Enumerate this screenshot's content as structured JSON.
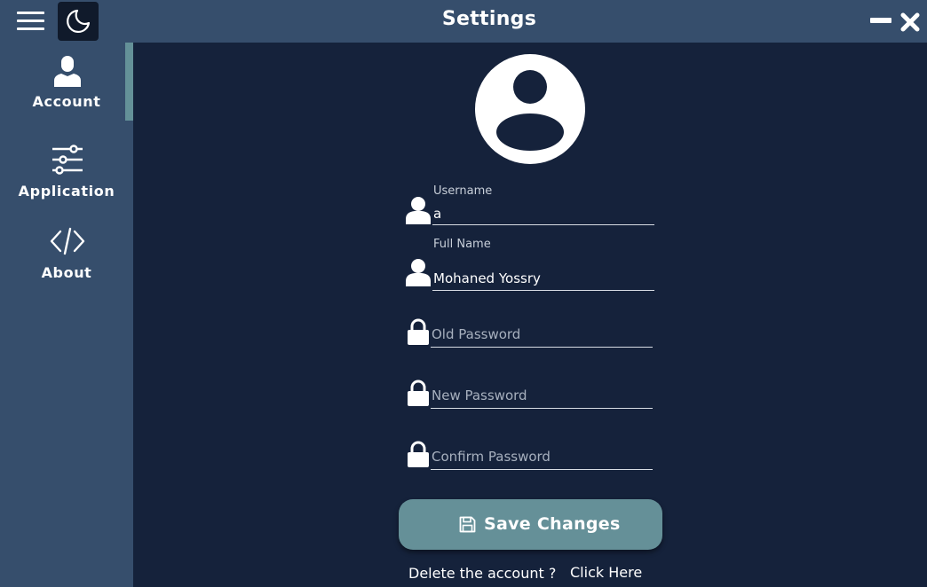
{
  "window": {
    "title": "Settings"
  },
  "sidebar": {
    "items": [
      {
        "label": "Account",
        "icon": "user-icon",
        "active": true
      },
      {
        "label": "Application",
        "icon": "sliders-icon",
        "active": false
      },
      {
        "label": "About",
        "icon": "code-icon",
        "active": false
      }
    ]
  },
  "form": {
    "username": {
      "label": "Username",
      "value": "a",
      "icon": "user-icon"
    },
    "full_name": {
      "label": "Full Name",
      "value": "Mohaned Yossry",
      "icon": "user-icon"
    },
    "old_password": {
      "placeholder": "Old Password",
      "icon": "lock-icon"
    },
    "new_password": {
      "placeholder": "New Password",
      "icon": "lock-icon"
    },
    "confirm_password": {
      "placeholder": "Confirm Password",
      "icon": "lock-icon"
    },
    "save_label": "Save Changes",
    "delete_prompt": "Delete the account ?",
    "delete_link": "Click Here"
  },
  "colors": {
    "background": "#15223b",
    "sidebar": "#364e6c",
    "accent": "#659098",
    "text": "#ffffff"
  }
}
